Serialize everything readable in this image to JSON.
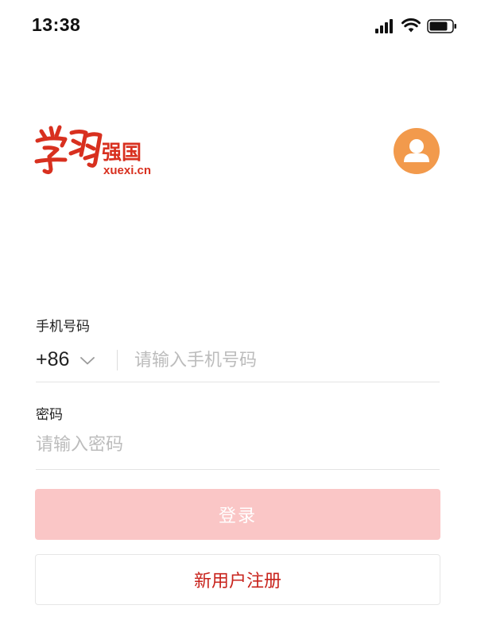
{
  "status_bar": {
    "time": "13:38",
    "icons": [
      "signal-icon",
      "wifi-icon",
      "battery-icon"
    ]
  },
  "logo": {
    "script_text": "学习",
    "cn_text": "强国",
    "domain": "xuexi.cn",
    "color": "#d8301f"
  },
  "avatar": {
    "icon": "user-icon",
    "color": "#f29a4c"
  },
  "form": {
    "phone_label": "手机号码",
    "country_code": "+86",
    "phone_placeholder": "请输入手机号码",
    "phone_value": "",
    "password_label": "密码",
    "password_placeholder": "请输入密码",
    "password_value": ""
  },
  "buttons": {
    "login_label": "登录",
    "login_color": "#fac6c6",
    "register_label": "新用户注册",
    "register_color": "#c8231c"
  }
}
